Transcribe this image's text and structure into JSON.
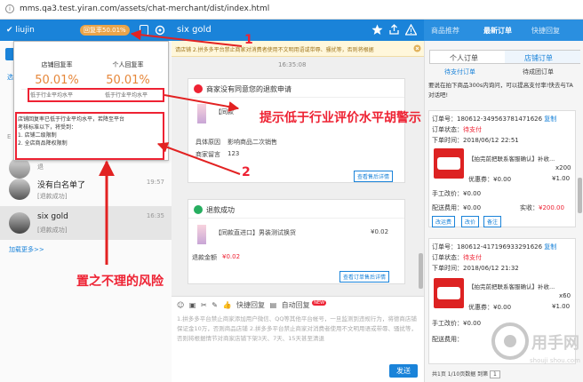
{
  "browser": {
    "url": "mms.qa3.test.yiran.com/assets/chat-merchant/dist/index.html"
  },
  "left_header": {
    "user": "liujin",
    "rate_badge": "回复率50.01%"
  },
  "chat_header": {
    "title": "six gold"
  },
  "right_tabs": [
    {
      "label": "商品推荐"
    },
    {
      "label": "最新订单"
    },
    {
      "label": "快捷回复"
    }
  ],
  "popup": {
    "store_label": "店铺回复率",
    "store_value": "50.01%",
    "personal_label": "个人回复率",
    "personal_value": "50.01%",
    "store_low": "低于行业平均水平",
    "personal_low": "低于行业平均水平",
    "note_lines": [
      "店铺回复率已低于行业平均水平，若降至平台",
      "考核标准以下，将受到：",
      "1. 店铺二级限制",
      "2. 全店商品降权限制"
    ]
  },
  "left_sidebar": {
    "label_1": "选",
    "label_2": "E"
  },
  "chat_list": [
    {
      "title": "",
      "sub": "退",
      "time": ""
    },
    {
      "title": "没有白名单了",
      "sub": "[退款成功]",
      "time": "19:57"
    },
    {
      "title": "six gold",
      "sub": "[退款成功]",
      "time": "16:35"
    }
  ],
  "load_more": "加载更多>>",
  "banner": "请店铺 2.拼多多平台禁止商家对消费者使用不文明用语或带辱、骚扰等，否则将根据",
  "timestamp": "16:35:08",
  "card1": {
    "title": "商家没有同意您的退款申请",
    "product": "【同款",
    "reason_label": "具体原因",
    "reason": "影响商品二次销售",
    "message_label": "商家留言",
    "message": "123",
    "button": "查看售后详情"
  },
  "card2": {
    "title": "退款成功",
    "product": "【同款直进口】男装测试换货",
    "price": "¥0.02",
    "amount_label": "退款金额",
    "amount": "¥0.02",
    "button": "查看订单售后详情"
  },
  "editor": {
    "quick_reply": "快捷回复",
    "auto_reply": "自动回复",
    "new_badge": "NEW",
    "placeholder": "1.拼多多平台禁止商家添加用户微信、QQ等其他平台帐号，一旦监测到违规行为，将德商店铺保证金10万，否则商品店铺 2.拼多多平台禁止商家对消费者使用不文明用语或带辱、骚扰等，否则将根据情节对商家店铺下架3天、7天、15天甚至清退",
    "send": "发送"
  },
  "right_panel": {
    "sub_tabs": [
      {
        "label": "个人订单"
      },
      {
        "label": "店铺订单"
      }
    ],
    "status_tabs": [
      {
        "label": "待支付订单"
      },
      {
        "label": "待成团订单"
      }
    ],
    "notice": "要说在拍下商品300s内询问，可以提高支付率!快去与TA对话吧!",
    "orders": [
      {
        "order_no_label": "订单号：",
        "order_no": "180612-349563781471626",
        "copy": "复制",
        "status_label": "订单状态：",
        "status": "待支付",
        "time_label": "下单时间：",
        "time": "2018/06/12 22:51",
        "item": "【拍完前把联系客服确认】补收...",
        "qty": "x200",
        "coupon_label": "优惠券：",
        "coupon": "¥0.00",
        "unit_price": "¥1.00",
        "manual_label": "手工改价：",
        "manual": "¥0.00",
        "ship_label": "配送费用：",
        "ship": "¥0.00",
        "paid_label": "实收：",
        "paid": "¥200.00",
        "buttons": [
          "改运费",
          "改价",
          "备注"
        ]
      },
      {
        "order_no_label": "订单号：",
        "order_no": "180612-417196933291626",
        "copy": "复制",
        "status_label": "订单状态：",
        "status": "待支付",
        "time_label": "下单时间：",
        "time": "2018/06/12 21:32",
        "item": "【拍完前把联系客服确认】补收...",
        "qty": "x60",
        "coupon_label": "优惠券：",
        "coupon": "¥0.00",
        "unit_price": "¥1.00",
        "manual_label": "手工改价：",
        "manual": "¥0.00",
        "ship_label": "配送费用："
      }
    ],
    "pager": "共1页 1/10页数据 到第",
    "page": "1"
  },
  "annotations": {
    "label_1": "1",
    "label_2": "2",
    "below_avg": "提示低于行业评价水平胡警示",
    "risk": "置之不理的风险",
    "color": "#e22222"
  },
  "watermark": {
    "text": "用手网",
    "sub": "shouji shou.com"
  }
}
